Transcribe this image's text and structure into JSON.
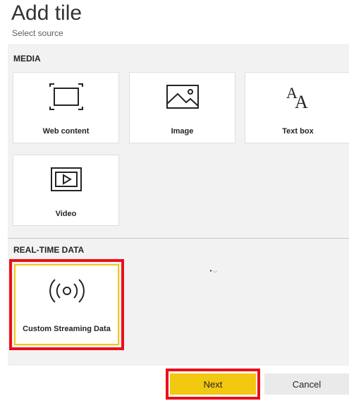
{
  "dialog": {
    "title": "Add tile",
    "subtitle": "Select source"
  },
  "media": {
    "heading": "MEDIA",
    "tiles": [
      {
        "label": "Web content",
        "icon": "frame-icon"
      },
      {
        "label": "Image",
        "icon": "image-icon"
      },
      {
        "label": "Text box",
        "icon": "text-box-icon"
      },
      {
        "label": "Video",
        "icon": "video-icon"
      }
    ]
  },
  "realtime": {
    "heading": "REAL-TIME DATA",
    "tiles": [
      {
        "label": "Custom Streaming Data",
        "icon": "streaming-icon",
        "selected": true
      }
    ]
  },
  "actions": {
    "next_label": "Next",
    "cancel_label": "Cancel"
  },
  "colors": {
    "accent": "#f2c811",
    "highlight": "#e8101a"
  }
}
